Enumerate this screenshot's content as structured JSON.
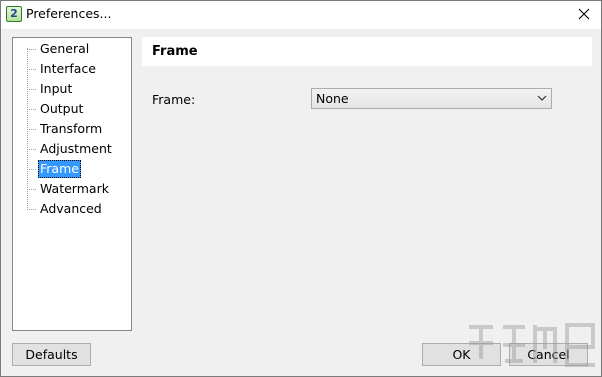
{
  "window": {
    "title": "Preferences...",
    "app_icon_text": "2"
  },
  "tree": {
    "items": [
      {
        "label": "General"
      },
      {
        "label": "Interface"
      },
      {
        "label": "Input"
      },
      {
        "label": "Output"
      },
      {
        "label": "Transform"
      },
      {
        "label": "Adjustment"
      },
      {
        "label": "Frame",
        "selected": true
      },
      {
        "label": "Watermark"
      },
      {
        "label": "Advanced"
      }
    ]
  },
  "panel": {
    "title": "Frame",
    "frame_label": "Frame:",
    "frame_value": "None"
  },
  "buttons": {
    "defaults": "Defaults",
    "ok": "OK",
    "cancel": "Cancel"
  },
  "colors": {
    "selection": "#3399ff",
    "dialog_bg": "#f0f0f0"
  }
}
